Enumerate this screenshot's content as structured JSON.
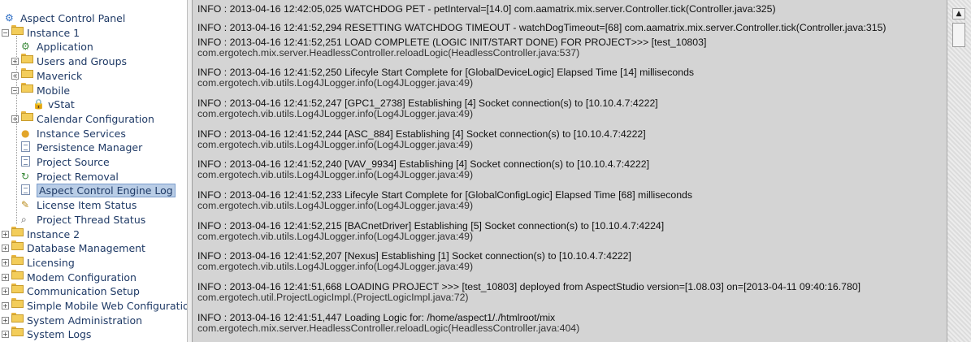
{
  "tree": {
    "root": "Aspect Control Panel",
    "instance1": "Instance 1",
    "instance1_children": [
      "Application",
      "Users and Groups",
      "Maverick",
      "Mobile",
      "Calendar Configuration",
      "Instance Services",
      "Persistence Manager",
      "Project Source",
      "Project Removal",
      "Aspect Control Engine Log",
      "License Item Status",
      "Project Thread Status"
    ],
    "mobile_children": [
      "vStat"
    ],
    "top_level": [
      "Instance 2",
      "Database Management",
      "Licensing",
      "Modem Configuration",
      "Communication Setup",
      "Simple Mobile Web Configuratio",
      "System Administration",
      "System Logs"
    ],
    "selected": "Aspect Control Engine Log"
  },
  "log": [
    [
      "INFO : 2013-04-16 12:42:05,025 WATCHDOG PET - petInterval=[14.0] com.aamatrix.mix.server.Controller.tick(Controller.java:325)",
      ""
    ],
    [
      "INFO : 2013-04-16 12:41:52,294 RESETTING WATCHDOG TIMEOUT - watchDogTimeout=[68] com.aamatrix.mix.server.Controller.tick(Controller.java:315)",
      ""
    ],
    [
      "INFO : 2013-04-16 12:41:52,251 LOAD COMPLETE (LOGIC INIT/START DONE) FOR PROJECT>>> [test_10803]",
      "com.ergotech.mix.server.HeadlessController.reloadLogic(HeadlessController.java:537)"
    ],
    [
      "INFO : 2013-04-16 12:41:52,250 Lifecyle Start Complete for [GlobalDeviceLogic] Elapsed Time [14] milliseconds",
      "com.ergotech.vib.utils.Log4JLogger.info(Log4JLogger.java:49)"
    ],
    [
      "INFO : 2013-04-16 12:41:52,247 [GPC1_2738] Establishing [4] Socket connection(s) to [10.10.4.7:4222]",
      "com.ergotech.vib.utils.Log4JLogger.info(Log4JLogger.java:49)"
    ],
    [
      "INFO : 2013-04-16 12:41:52,244 [ASC_884] Establishing [4] Socket connection(s) to [10.10.4.7:4222]",
      "com.ergotech.vib.utils.Log4JLogger.info(Log4JLogger.java:49)"
    ],
    [
      "INFO : 2013-04-16 12:41:52,240 [VAV_9934] Establishing [4] Socket connection(s) to [10.10.4.7:4222]",
      "com.ergotech.vib.utils.Log4JLogger.info(Log4JLogger.java:49)"
    ],
    [
      "INFO : 2013-04-16 12:41:52,233 Lifecyle Start Complete for [GlobalConfigLogic] Elapsed Time [68] milliseconds",
      "com.ergotech.vib.utils.Log4JLogger.info(Log4JLogger.java:49)"
    ],
    [
      "INFO : 2013-04-16 12:41:52,215 [BACnetDriver] Establishing [5] Socket connection(s) to [10.10.4.7:4224]",
      "com.ergotech.vib.utils.Log4JLogger.info(Log4JLogger.java:49)"
    ],
    [
      "INFO : 2013-04-16 12:41:52,207 [Nexus] Establishing [1] Socket connection(s) to [10.10.4.7:4222]",
      "com.ergotech.vib.utils.Log4JLogger.info(Log4JLogger.java:49)"
    ],
    [
      "INFO : 2013-04-16 12:41:51,668 LOADING PROJECT >>> [test_10803] deployed from AspectStudio version=[1.08.03] on=[2013-04-11 09:40:16.780]",
      "com.ergotech.util.ProjectLogicImpl.(ProjectLogicImpl.java:72)"
    ],
    [
      "INFO : 2013-04-16 12:41:51,447 Loading Logic for: /home/aspect1/./htmlroot/mix",
      "com.ergotech.mix.server.HeadlessController.reloadLogic(HeadlessController.java:404)"
    ]
  ],
  "icons": {
    "root": "control-panel-icon",
    "folder": "folder-icon",
    "application": "globe-gear-icon",
    "vstat": "thermostat-icon",
    "instance_services": "services-icon",
    "document": "document-icon",
    "license": "key-icon",
    "thread": "magnifier-icon"
  }
}
